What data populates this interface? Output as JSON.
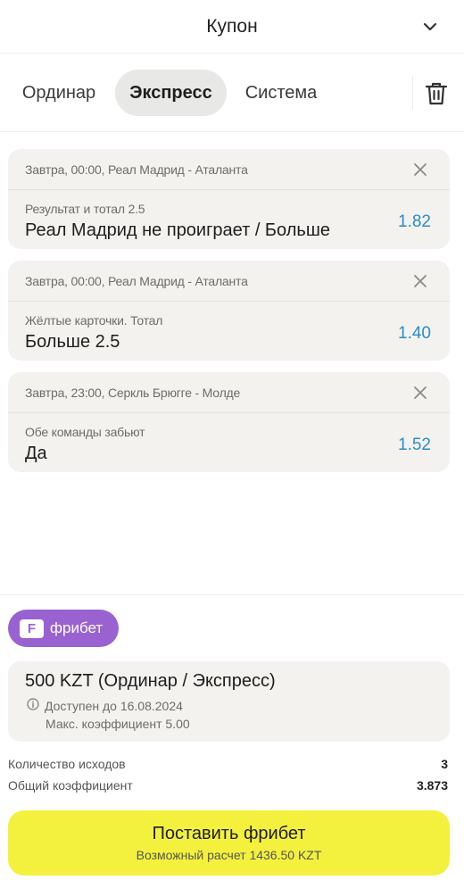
{
  "header": {
    "title": "Купон",
    "chevron_icon": "chevron-down-icon"
  },
  "tabs": [
    {
      "label": "Ординар",
      "active": false
    },
    {
      "label": "Экспресс",
      "active": true
    },
    {
      "label": "Система",
      "active": false
    }
  ],
  "tabs_actions": {
    "delete_icon": "trash-icon"
  },
  "bets": [
    {
      "event": "Завтра, 00:00, Реал Мадрид - Аталанта",
      "market": "Результат и тотал 2.5",
      "selection": "Реал Мадрид не проиграет / Больше",
      "odds": "1.82"
    },
    {
      "event": "Завтра, 00:00, Реал Мадрид - Аталанта",
      "market": "Жёлтые карточки. Тотал",
      "selection": "Больше 2.5",
      "odds": "1.40"
    },
    {
      "event": "Завтра, 23:00, Серкль Брюгге - Молде",
      "market": "Обе команды забьют",
      "selection": "Да",
      "odds": "1.52"
    }
  ],
  "freebet": {
    "badge_label": "фрибет",
    "badge_icon_letter": "F",
    "title": "500 KZT (Ординар / Экспресс)",
    "available": "Доступен до 16.08.2024",
    "max_coef": "Макс. коэффициент 5.00"
  },
  "summary": {
    "outcomes_label": "Количество исходов",
    "outcomes_value": "3",
    "total_coef_label": "Общий коэффициент",
    "total_coef_value": "3.873"
  },
  "place_button": {
    "title": "Поставить фрибет",
    "subtitle": "Возможный расчет 1436.50 KZT"
  },
  "colors": {
    "accent_odds": "#2b8dc4",
    "freebet_purple": "#9a62d1",
    "cta_yellow": "#f4f13e",
    "card_bg": "#f3f2ef",
    "active_tab_bg": "#e8e8e6"
  }
}
